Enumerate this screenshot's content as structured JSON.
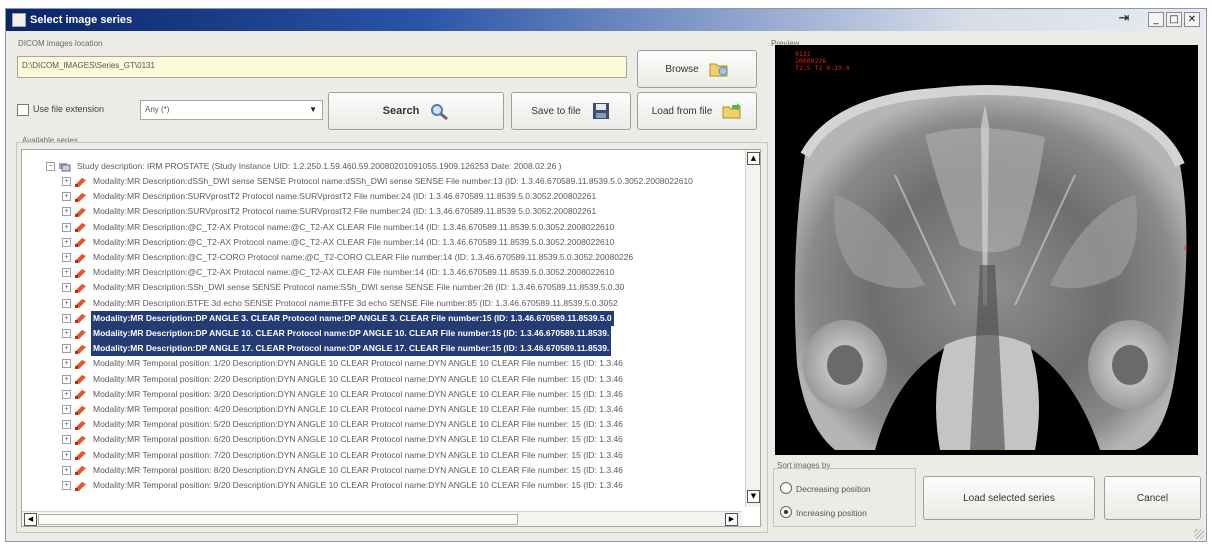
{
  "window": {
    "title": "Select image series"
  },
  "dicom": {
    "group_label": "DICOM images location",
    "path_value": "D:\\DICOM_IMAGES\\Series_GT\\0131",
    "browse_label": "Browse",
    "use_extension_label": "Use file extension",
    "extension_value": "Any (*)",
    "search_label": "Search",
    "save_label": "Save to file",
    "load_label": "Load from file"
  },
  "series": {
    "group_label": "Available series",
    "study": "Study description: IRM PROSTATE (Study Instance UID: 1.2.250.1.59.460.59.20080201091055.1909.126253 Date: 2008.02.26 )",
    "rows": [
      {
        "text": "Modality:MR Description:dSSh_DWI sense SENSE Protocol name:dSSh_DWI sense SENSE File number:13 (ID: 1.3.46.670589.11.8539.5.0.3052.2008022610",
        "selected": false
      },
      {
        "text": "Modality:MR Description:SURVprostT2 Protocol name:SURVprostT2 File number:24 (ID: 1.3.46.670589.11.8539.5.0.3052.200802261",
        "selected": false
      },
      {
        "text": "Modality:MR Description:SURVprostT2 Protocol name:SURVprostT2 File number:24 (ID: 1.3.46.670589.11.8539.5.0.3052.200802261",
        "selected": false
      },
      {
        "text": "Modality:MR Description:@C_T2-AX Protocol name:@C_T2-AX CLEAR File number:14 (ID: 1.3.46.670589.11.8539.5.0.3052.2008022610",
        "selected": false
      },
      {
        "text": "Modality:MR Description:@C_T2-AX Protocol name:@C_T2-AX CLEAR File number:14 (ID: 1.3.46.670589.11.8539.5.0.3052.2008022610",
        "selected": false
      },
      {
        "text": "Modality:MR Description:@C_T2-CORO Protocol name:@C_T2-CORO CLEAR File number:14 (ID: 1.3.46.670589.11.8539.5.0.3052.20080226",
        "selected": false
      },
      {
        "text": "Modality:MR Description:@C_T2-AX Protocol name:@C_T2-AX CLEAR File number:14 (ID: 1.3.46.670589.11.8539.5.0.3052.2008022610",
        "selected": false
      },
      {
        "text": "Modality:MR Description:SSh_DWI sense SENSE Protocol name:SSh_DWI sense SENSE File number:26 (ID: 1.3.46.670589.11.8539.5.0.30",
        "selected": false
      },
      {
        "text": "Modality:MR Description:BTFE 3d echo SENSE Protocol name:BTFE 3d echo SENSE File number:85 (ID: 1.3.46.670589.11.8539.5.0.3052",
        "selected": false
      },
      {
        "text": "Modality:MR Description:DP ANGLE 3. CLEAR Protocol name:DP ANGLE 3. CLEAR File number:15 (ID: 1.3.46.670589.11.8539.5.0",
        "selected": true
      },
      {
        "text": "Modality:MR Description:DP ANGLE 10. CLEAR Protocol name:DP ANGLE 10. CLEAR File number:15 (ID: 1.3.46.670589.11.8539.",
        "selected": true
      },
      {
        "text": "Modality:MR Description:DP ANGLE 17. CLEAR Protocol name:DP ANGLE 17. CLEAR File number:15 (ID: 1.3.46.670589.11.8539.",
        "selected": true
      },
      {
        "text": "Modality:MR Temporal position: 1/20 Description:DYN ANGLE 10 CLEAR Protocol name:DYN ANGLE 10 CLEAR File number: 15 (ID: 1.3.46",
        "selected": false
      },
      {
        "text": "Modality:MR Temporal position: 2/20 Description:DYN ANGLE 10 CLEAR Protocol name:DYN ANGLE 10 CLEAR File number: 15 (ID: 1.3.46",
        "selected": false
      },
      {
        "text": "Modality:MR Temporal position: 3/20 Description:DYN ANGLE 10 CLEAR Protocol name:DYN ANGLE 10 CLEAR File number: 15 (ID: 1.3.46",
        "selected": false
      },
      {
        "text": "Modality:MR Temporal position: 4/20 Description:DYN ANGLE 10 CLEAR Protocol name:DYN ANGLE 10 CLEAR File number: 15 (ID: 1.3.46",
        "selected": false
      },
      {
        "text": "Modality:MR Temporal position: 5/20 Description:DYN ANGLE 10 CLEAR Protocol name:DYN ANGLE 10 CLEAR File number: 15 (ID: 1.3.46",
        "selected": false
      },
      {
        "text": "Modality:MR Temporal position: 6/20 Description:DYN ANGLE 10 CLEAR Protocol name:DYN ANGLE 10 CLEAR File number: 15 (ID: 1.3.46",
        "selected": false
      },
      {
        "text": "Modality:MR Temporal position: 7/20 Description:DYN ANGLE 10 CLEAR Protocol name:DYN ANGLE 10 CLEAR File number: 15 (ID: 1.3.46",
        "selected": false
      },
      {
        "text": "Modality:MR Temporal position: 8/20 Description:DYN ANGLE 10 CLEAR Protocol name:DYN ANGLE 10 CLEAR File number: 15 (ID: 1.3.46",
        "selected": false
      },
      {
        "text": "Modality:MR Temporal position: 9/20 Description:DYN ANGLE 10 CLEAR Protocol name:DYN ANGLE 10 CLEAR File number: 15 (ID: 1.3.46",
        "selected": false
      }
    ]
  },
  "preview": {
    "group_label": "Preview",
    "overlay_lines": [
      "0131",
      "20080226",
      "T2.5 T2 0.19.0"
    ],
    "side_marker": "L"
  },
  "sort": {
    "group_label": "Sort images by",
    "decreasing_label": "Decreasing position",
    "increasing_label": "Increasing position",
    "selected": "increasing"
  },
  "actions": {
    "load_selected_label": "Load selected series",
    "cancel_label": "Cancel"
  },
  "colors": {
    "selection": "#253b74",
    "path_field_bg": "#fbfbd9",
    "overlay_text": "#e02020"
  }
}
